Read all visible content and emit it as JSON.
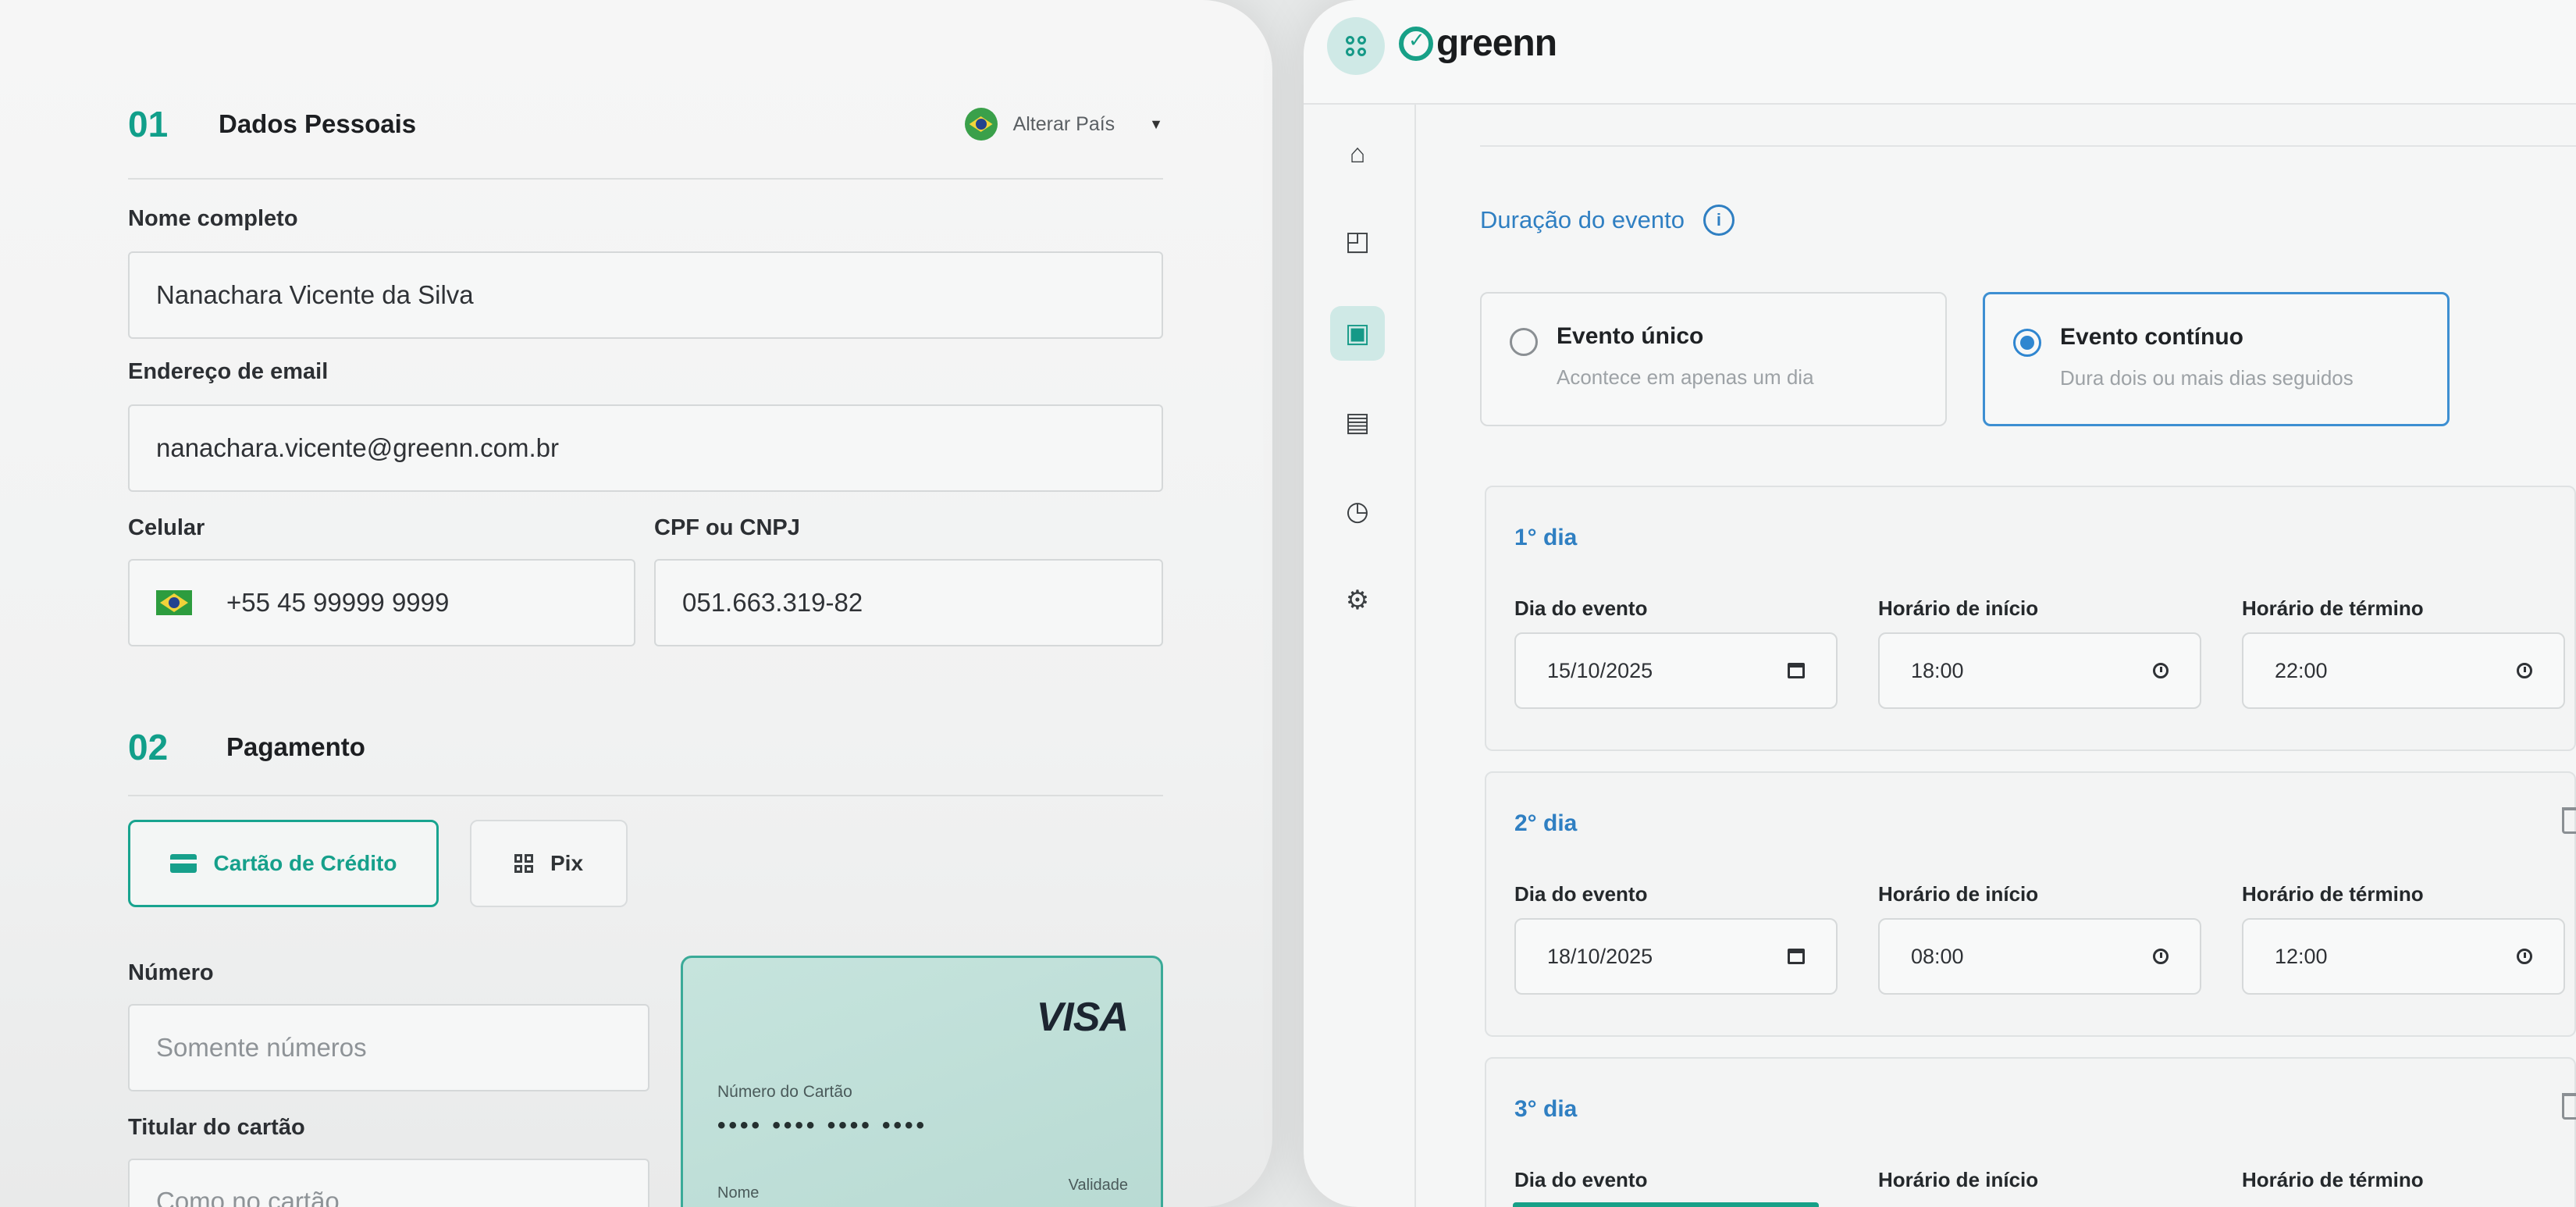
{
  "checkout": {
    "personal": {
      "number": "01",
      "title": "Dados Pessoais",
      "change_country": "Alterar País"
    },
    "fields": {
      "name_label": "Nome completo",
      "name_value": "Nanachara Vicente da Silva",
      "email_label": "Endereço de email",
      "email_value": "nanachara.vicente@greenn.com.br",
      "phone_label": "Celular",
      "phone_value": "+55 45 99999 9999",
      "doc_label": "CPF ou CNPJ",
      "doc_value": "051.663.319-82"
    },
    "payment": {
      "number": "02",
      "title": "Pagamento",
      "credit_card": "Cartão de Crédito",
      "pix": "Pix",
      "number_label": "Número",
      "number_placeholder": "Somente números",
      "holder_label": "Titular do cartão",
      "holder_placeholder": "Como no cartão"
    },
    "card_preview": {
      "brand": "VISA",
      "number_label": "Número do Cartão",
      "number_mask": "•••• •••• •••• ••••",
      "name_label": "Nome",
      "validity_label": "Validade"
    }
  },
  "event_app": {
    "logo_text": "greenn",
    "sidebar_icons": [
      "home-icon",
      "bag-icon",
      "calendar-icon",
      "wallet-icon",
      "clock-icon",
      "gear-icon"
    ],
    "duration_title": "Duração do evento",
    "type_single": {
      "title": "Evento único",
      "subtitle": "Acontece em apenas um dia"
    },
    "type_continuous": {
      "title": "Evento contínuo",
      "subtitle": "Dura dois ou mais dias seguidos"
    },
    "field_labels": {
      "date": "Dia do evento",
      "start": "Horário de início",
      "end": "Horário de término"
    },
    "days": [
      {
        "title": "1° dia",
        "date": "15/10/2025",
        "start": "18:00",
        "end": "22:00"
      },
      {
        "title": "2° dia",
        "date": "18/10/2025",
        "start": "08:00",
        "end": "12:00"
      },
      {
        "title": "3° dia"
      }
    ],
    "colors": {
      "accent_green": "#17a087",
      "accent_blue": "#2f7fc2"
    }
  }
}
